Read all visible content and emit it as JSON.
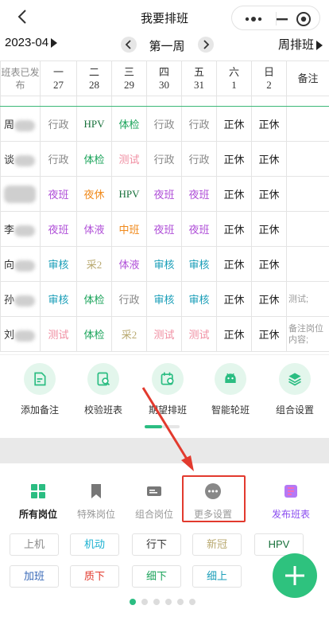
{
  "header": {
    "title": "我要排班"
  },
  "week_bar": {
    "month": "2023-04",
    "week_label": "第一周",
    "mode_label": "周排班"
  },
  "schedule": {
    "corner_label": "班表已发布",
    "days": [
      {
        "day": "一",
        "date": "27"
      },
      {
        "day": "二",
        "date": "28"
      },
      {
        "day": "三",
        "date": "29"
      },
      {
        "day": "四",
        "date": "30"
      },
      {
        "day": "五",
        "date": "31"
      },
      {
        "day": "六",
        "date": "1"
      },
      {
        "day": "日",
        "date": "2"
      }
    ],
    "note_header": "备注",
    "rows": [
      {
        "name": "周",
        "cells": [
          {
            "text": "行政",
            "color": "#888888"
          },
          {
            "text": "HPV",
            "color": "#16703a"
          },
          {
            "text": "体检",
            "color": "#1aa35a"
          },
          {
            "text": "行政",
            "color": "#888888"
          },
          {
            "text": "行政",
            "color": "#888888"
          },
          {
            "text": "正休",
            "color": "#222222"
          },
          {
            "text": "正休",
            "color": "#222222"
          }
        ],
        "note": ""
      },
      {
        "name": "谈",
        "cells": [
          {
            "text": "行政",
            "color": "#888888"
          },
          {
            "text": "体检",
            "color": "#1aa35a"
          },
          {
            "text": "测试",
            "color": "#f08ca0"
          },
          {
            "text": "行政",
            "color": "#888888"
          },
          {
            "text": "行政",
            "color": "#888888"
          },
          {
            "text": "正休",
            "color": "#222222"
          },
          {
            "text": "正休",
            "color": "#222222"
          }
        ],
        "note": ""
      },
      {
        "name": "",
        "cells": [
          {
            "text": "夜班",
            "color": "#b050d8"
          },
          {
            "text": "夜休",
            "color": "#f08a1c"
          },
          {
            "text": "HPV",
            "color": "#16703a"
          },
          {
            "text": "夜班",
            "color": "#b050d8"
          },
          {
            "text": "夜班",
            "color": "#b050d8"
          },
          {
            "text": "正休",
            "color": "#222222"
          },
          {
            "text": "正休",
            "color": "#222222"
          }
        ],
        "note": ""
      },
      {
        "name": "李",
        "cells": [
          {
            "text": "夜班",
            "color": "#b050d8"
          },
          {
            "text": "体液",
            "color": "#b050d8"
          },
          {
            "text": "中班",
            "color": "#f08a1c"
          },
          {
            "text": "夜班",
            "color": "#b050d8"
          },
          {
            "text": "夜班",
            "color": "#b050d8"
          },
          {
            "text": "正休",
            "color": "#222222"
          },
          {
            "text": "正休",
            "color": "#222222"
          }
        ],
        "note": ""
      },
      {
        "name": "向",
        "cells": [
          {
            "text": "审核",
            "color": "#1a9eb8"
          },
          {
            "text": "采2",
            "color": "#b9a970"
          },
          {
            "text": "体液",
            "color": "#b050d8"
          },
          {
            "text": "审核",
            "color": "#1a9eb8"
          },
          {
            "text": "审核",
            "color": "#1a9eb8"
          },
          {
            "text": "正休",
            "color": "#222222"
          },
          {
            "text": "正休",
            "color": "#222222"
          }
        ],
        "note": ""
      },
      {
        "name": "孙",
        "cells": [
          {
            "text": "审核",
            "color": "#1a9eb8"
          },
          {
            "text": "体检",
            "color": "#1aa35a"
          },
          {
            "text": "行政",
            "color": "#888888"
          },
          {
            "text": "审核",
            "color": "#1a9eb8"
          },
          {
            "text": "审核",
            "color": "#1a9eb8"
          },
          {
            "text": "正休",
            "color": "#222222"
          },
          {
            "text": "正休",
            "color": "#222222"
          }
        ],
        "note": "测试;"
      },
      {
        "name": "刘",
        "cells": [
          {
            "text": "测试",
            "color": "#f08ca0"
          },
          {
            "text": "体检",
            "color": "#1aa35a"
          },
          {
            "text": "采2",
            "color": "#b9a970"
          },
          {
            "text": "测试",
            "color": "#f08ca0"
          },
          {
            "text": "测试",
            "color": "#f08ca0"
          },
          {
            "text": "正休",
            "color": "#222222"
          },
          {
            "text": "正休",
            "color": "#222222"
          }
        ],
        "note": "备注岗位内容;"
      }
    ]
  },
  "tools": [
    {
      "label": "添加备注",
      "icon": "edit-note-icon"
    },
    {
      "label": "校验班表",
      "icon": "check-table-icon"
    },
    {
      "label": "期望排班",
      "icon": "expect-schedule-icon"
    },
    {
      "label": "智能轮班",
      "icon": "android-robot-icon"
    },
    {
      "label": "组合设置",
      "icon": "layers-icon"
    }
  ],
  "bottom_tabs": [
    {
      "label": "所有岗位",
      "icon": "grid-icon",
      "state": "selected"
    },
    {
      "label": "特殊岗位",
      "icon": "bookmark-icon",
      "state": "dim"
    },
    {
      "label": "组合岗位",
      "icon": "ticket-icon",
      "state": "dim"
    },
    {
      "label": "更多设置",
      "icon": "more-dots-icon",
      "state": "dim"
    },
    {
      "label": "发布班表",
      "icon": "publish-icon",
      "state": "publish"
    }
  ],
  "shift_chips": [
    {
      "label": "上机",
      "color": "#888888"
    },
    {
      "label": "机动",
      "color": "#1ab0d0"
    },
    {
      "label": "行下",
      "color": "#333333"
    },
    {
      "label": "新冠",
      "color": "#b9a970"
    },
    {
      "label": "HPV",
      "color": "#16703a"
    },
    {
      "label": "加班",
      "color": "#3a6ab8"
    },
    {
      "label": "质下",
      "color": "#e23a2e"
    },
    {
      "label": "细下",
      "color": "#1aa35a"
    },
    {
      "label": "细上",
      "color": "#1a9eb8"
    }
  ],
  "colors": {
    "accent": "#2ec27e",
    "highlight": "#e23a2e",
    "publish": "#8a4cf0"
  }
}
